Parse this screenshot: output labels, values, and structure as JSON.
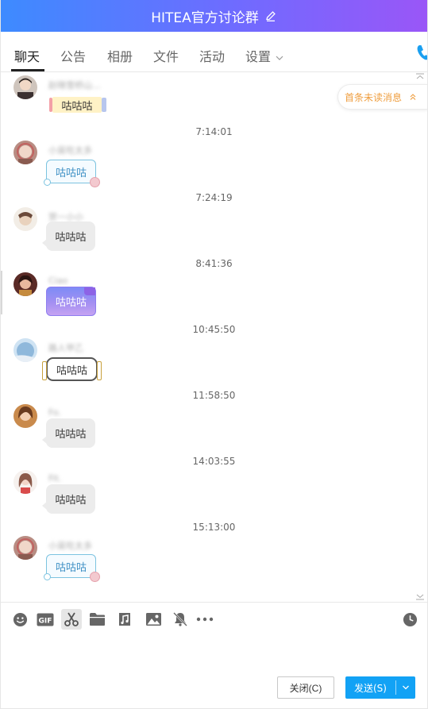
{
  "window": {
    "title": "HITEA官方讨论群"
  },
  "tabs": [
    {
      "label": "聊天",
      "active": true
    },
    {
      "label": "公告",
      "active": false
    },
    {
      "label": "相册",
      "active": false
    },
    {
      "label": "文件",
      "active": false
    },
    {
      "label": "活动",
      "active": false
    },
    {
      "label": "设置",
      "active": false
    }
  ],
  "unread_banner": {
    "label": "首条未读消息"
  },
  "messages": [
    {
      "sender": "赵晓雪桥山…",
      "time": "",
      "text": "咕咕咕"
    },
    {
      "sender": "小吴吃太多",
      "time": "7:14:01",
      "text": "咕咕咕"
    },
    {
      "sender": "贺一小小",
      "time": "7:24:19",
      "text": "咕咕咕"
    },
    {
      "sender": "Ciao",
      "time": "8:41:36",
      "text": "咕咕咕"
    },
    {
      "sender": "路人甲乙",
      "time": "10:45:50",
      "text": "咕咕咕"
    },
    {
      "sender": "Fo.",
      "time": "11:58:50",
      "text": "咕咕咕"
    },
    {
      "sender": "Fit.",
      "time": "14:03:55",
      "text": "咕咕咕"
    },
    {
      "sender": "小吴吃太多",
      "time": "15:13:00",
      "text": "咕咕咕"
    }
  ],
  "buttons": {
    "close": "关闭(C)",
    "send": "发送(S)"
  },
  "colors": {
    "accent": "#12a2f5",
    "title_gradient_start": "#3d8bff",
    "title_gradient_end": "#9a56f7",
    "unread_text": "#ef9e3f"
  }
}
